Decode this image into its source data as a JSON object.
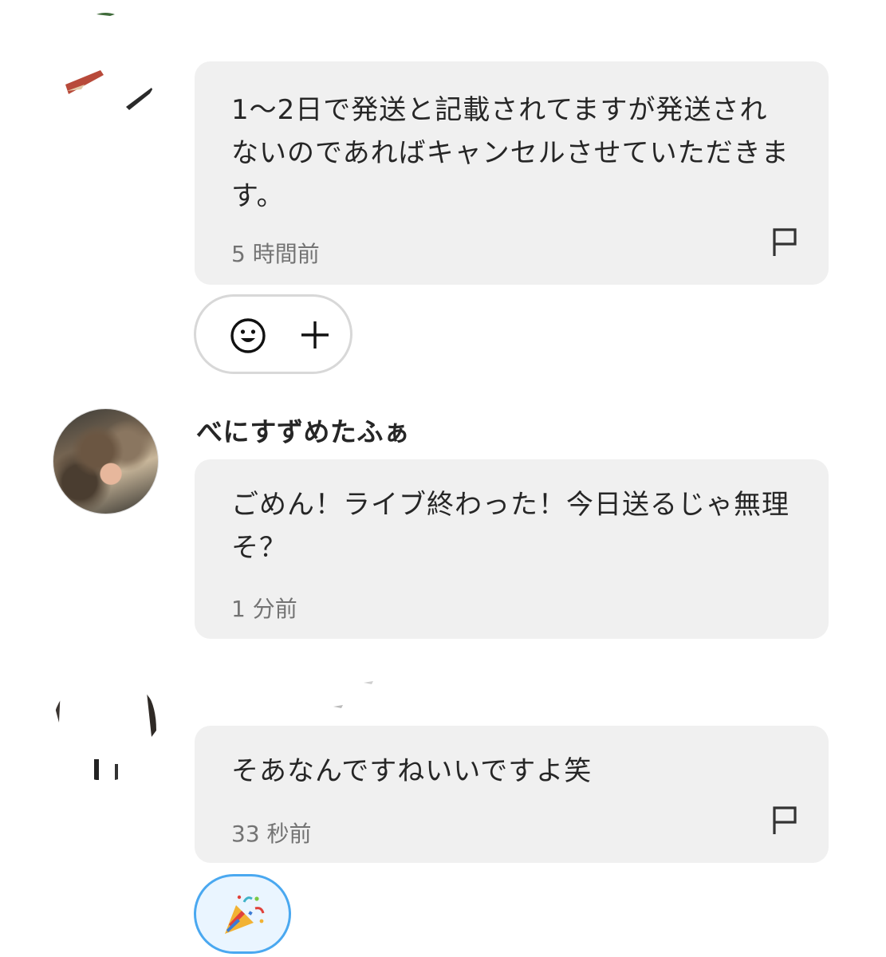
{
  "messages": [
    {
      "text": "1～2日で発送と記載されてますが発送されないのであればキャンセルさせていただきます。",
      "time": "5 時間前"
    },
    {
      "username": "べにすずめたふぁ",
      "text": "ごめん！ライブ終わった！今日送るじゃ無理そ？",
      "time": "1 分前"
    },
    {
      "text": "そあなんですねいいですよ笑",
      "time": "33 秒前"
    }
  ],
  "icons": {
    "flag": "flag-icon",
    "smiley": "smiley-icon",
    "plus": "plus-icon",
    "party": "party-popper-icon"
  },
  "colors": {
    "bubble": "#f0f0f0",
    "reaction_selected_border": "#4aa8f0"
  }
}
